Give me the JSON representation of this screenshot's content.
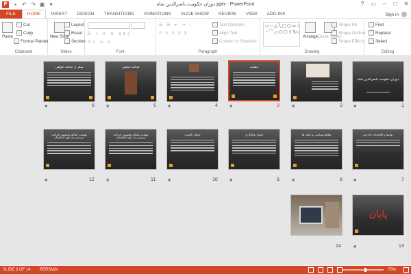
{
  "window": {
    "title": "دوران حکومت ناصرالدین شاه.pptx - PowerPoint",
    "app_icon": "P",
    "controls": [
      "?",
      "▭",
      "–",
      "□",
      "✕"
    ]
  },
  "ribbon_tabs": [
    "FILE",
    "HOME",
    "INSERT",
    "DESIGN",
    "TRANSITIONS",
    "ANIMATIONS",
    "SLIDE SHOW",
    "REVIEW",
    "VIEW",
    "ADD-INS"
  ],
  "active_tab": "HOME",
  "signin": "Sign in",
  "groups": {
    "clipboard": {
      "label": "Clipboard",
      "paste": "Paste",
      "cut": "Cut",
      "copy": "Copy",
      "format_painter": "Format Painter"
    },
    "slides": {
      "label": "Slides",
      "new_slide": "New Slide",
      "layout": "Layout",
      "reset": "Reset",
      "section": "Section"
    },
    "font": {
      "label": "Font"
    },
    "paragraph": {
      "label": "Paragraph",
      "text_direction": "Text Direction",
      "align_text": "Align Text",
      "convert": "Convert to SmartArt"
    },
    "drawing": {
      "label": "Drawing",
      "arrange": "Arrange",
      "quick_styles": "Quick Styles",
      "shape_fill": "Shape Fill",
      "shape_outline": "Shape Outline",
      "shape_effects": "Shape Effects"
    },
    "editing": {
      "label": "Editing",
      "find": "Find",
      "replace": "Replace",
      "select": "Select"
    }
  },
  "slides": [
    {
      "num": "1",
      "title": "دوران حکومت ناصرالدین شاه"
    },
    {
      "num": "2",
      "title": ""
    },
    {
      "num": "3",
      "title": "مقدمه",
      "selected": true
    },
    {
      "num": "4",
      "title": ""
    },
    {
      "num": "5",
      "title": "عدالت خواهی"
    },
    {
      "num": "6",
      "title": "سفر از عدالت خواهی"
    },
    {
      "num": "7",
      "title": "روابط و اقدامات خارجی"
    },
    {
      "num": "8",
      "title": "وقایع سیاسی و جنگ ها"
    },
    {
      "num": "9",
      "title": "امتیاز واگذاری"
    },
    {
      "num": "10",
      "title": "امتیاز تالبوت"
    },
    {
      "num": "11",
      "title": "نهضت تنباکو نخستین حرکت مردمی در عهد استعمار"
    },
    {
      "num": "12",
      "title": "نهضت تنباکو نخستین حرکت مردمی در عهد استعمار"
    },
    {
      "num": "13",
      "title": "پایان"
    },
    {
      "num": "14",
      "title": ""
    }
  ],
  "status": {
    "slide_of": "SLIDE 3 OF 14",
    "language": "PERSIAN",
    "zoom": "70%"
  }
}
